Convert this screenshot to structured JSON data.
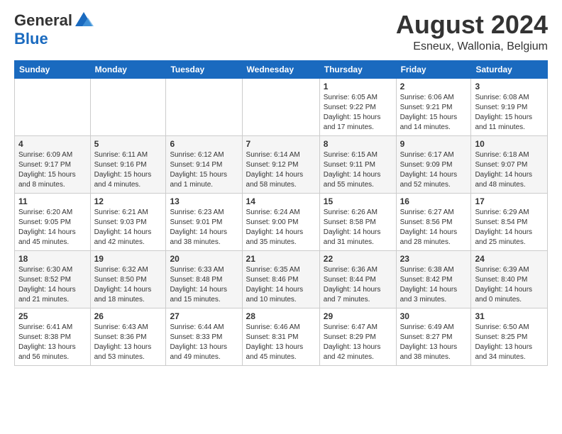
{
  "header": {
    "logo_line1": "General",
    "logo_line2": "Blue",
    "month_title": "August 2024",
    "location": "Esneux, Wallonia, Belgium"
  },
  "weekdays": [
    "Sunday",
    "Monday",
    "Tuesday",
    "Wednesday",
    "Thursday",
    "Friday",
    "Saturday"
  ],
  "weeks": [
    [
      {
        "day": "",
        "info": ""
      },
      {
        "day": "",
        "info": ""
      },
      {
        "day": "",
        "info": ""
      },
      {
        "day": "",
        "info": ""
      },
      {
        "day": "1",
        "info": "Sunrise: 6:05 AM\nSunset: 9:22 PM\nDaylight: 15 hours and 17 minutes."
      },
      {
        "day": "2",
        "info": "Sunrise: 6:06 AM\nSunset: 9:21 PM\nDaylight: 15 hours and 14 minutes."
      },
      {
        "day": "3",
        "info": "Sunrise: 6:08 AM\nSunset: 9:19 PM\nDaylight: 15 hours and 11 minutes."
      }
    ],
    [
      {
        "day": "4",
        "info": "Sunrise: 6:09 AM\nSunset: 9:17 PM\nDaylight: 15 hours and 8 minutes."
      },
      {
        "day": "5",
        "info": "Sunrise: 6:11 AM\nSunset: 9:16 PM\nDaylight: 15 hours and 4 minutes."
      },
      {
        "day": "6",
        "info": "Sunrise: 6:12 AM\nSunset: 9:14 PM\nDaylight: 15 hours and 1 minute."
      },
      {
        "day": "7",
        "info": "Sunrise: 6:14 AM\nSunset: 9:12 PM\nDaylight: 14 hours and 58 minutes."
      },
      {
        "day": "8",
        "info": "Sunrise: 6:15 AM\nSunset: 9:11 PM\nDaylight: 14 hours and 55 minutes."
      },
      {
        "day": "9",
        "info": "Sunrise: 6:17 AM\nSunset: 9:09 PM\nDaylight: 14 hours and 52 minutes."
      },
      {
        "day": "10",
        "info": "Sunrise: 6:18 AM\nSunset: 9:07 PM\nDaylight: 14 hours and 48 minutes."
      }
    ],
    [
      {
        "day": "11",
        "info": "Sunrise: 6:20 AM\nSunset: 9:05 PM\nDaylight: 14 hours and 45 minutes."
      },
      {
        "day": "12",
        "info": "Sunrise: 6:21 AM\nSunset: 9:03 PM\nDaylight: 14 hours and 42 minutes."
      },
      {
        "day": "13",
        "info": "Sunrise: 6:23 AM\nSunset: 9:01 PM\nDaylight: 14 hours and 38 minutes."
      },
      {
        "day": "14",
        "info": "Sunrise: 6:24 AM\nSunset: 9:00 PM\nDaylight: 14 hours and 35 minutes."
      },
      {
        "day": "15",
        "info": "Sunrise: 6:26 AM\nSunset: 8:58 PM\nDaylight: 14 hours and 31 minutes."
      },
      {
        "day": "16",
        "info": "Sunrise: 6:27 AM\nSunset: 8:56 PM\nDaylight: 14 hours and 28 minutes."
      },
      {
        "day": "17",
        "info": "Sunrise: 6:29 AM\nSunset: 8:54 PM\nDaylight: 14 hours and 25 minutes."
      }
    ],
    [
      {
        "day": "18",
        "info": "Sunrise: 6:30 AM\nSunset: 8:52 PM\nDaylight: 14 hours and 21 minutes."
      },
      {
        "day": "19",
        "info": "Sunrise: 6:32 AM\nSunset: 8:50 PM\nDaylight: 14 hours and 18 minutes."
      },
      {
        "day": "20",
        "info": "Sunrise: 6:33 AM\nSunset: 8:48 PM\nDaylight: 14 hours and 15 minutes."
      },
      {
        "day": "21",
        "info": "Sunrise: 6:35 AM\nSunset: 8:46 PM\nDaylight: 14 hours and 10 minutes."
      },
      {
        "day": "22",
        "info": "Sunrise: 6:36 AM\nSunset: 8:44 PM\nDaylight: 14 hours and 7 minutes."
      },
      {
        "day": "23",
        "info": "Sunrise: 6:38 AM\nSunset: 8:42 PM\nDaylight: 14 hours and 3 minutes."
      },
      {
        "day": "24",
        "info": "Sunrise: 6:39 AM\nSunset: 8:40 PM\nDaylight: 14 hours and 0 minutes."
      }
    ],
    [
      {
        "day": "25",
        "info": "Sunrise: 6:41 AM\nSunset: 8:38 PM\nDaylight: 13 hours and 56 minutes."
      },
      {
        "day": "26",
        "info": "Sunrise: 6:43 AM\nSunset: 8:36 PM\nDaylight: 13 hours and 53 minutes."
      },
      {
        "day": "27",
        "info": "Sunrise: 6:44 AM\nSunset: 8:33 PM\nDaylight: 13 hours and 49 minutes."
      },
      {
        "day": "28",
        "info": "Sunrise: 6:46 AM\nSunset: 8:31 PM\nDaylight: 13 hours and 45 minutes."
      },
      {
        "day": "29",
        "info": "Sunrise: 6:47 AM\nSunset: 8:29 PM\nDaylight: 13 hours and 42 minutes."
      },
      {
        "day": "30",
        "info": "Sunrise: 6:49 AM\nSunset: 8:27 PM\nDaylight: 13 hours and 38 minutes."
      },
      {
        "day": "31",
        "info": "Sunrise: 6:50 AM\nSunset: 8:25 PM\nDaylight: 13 hours and 34 minutes."
      }
    ]
  ]
}
